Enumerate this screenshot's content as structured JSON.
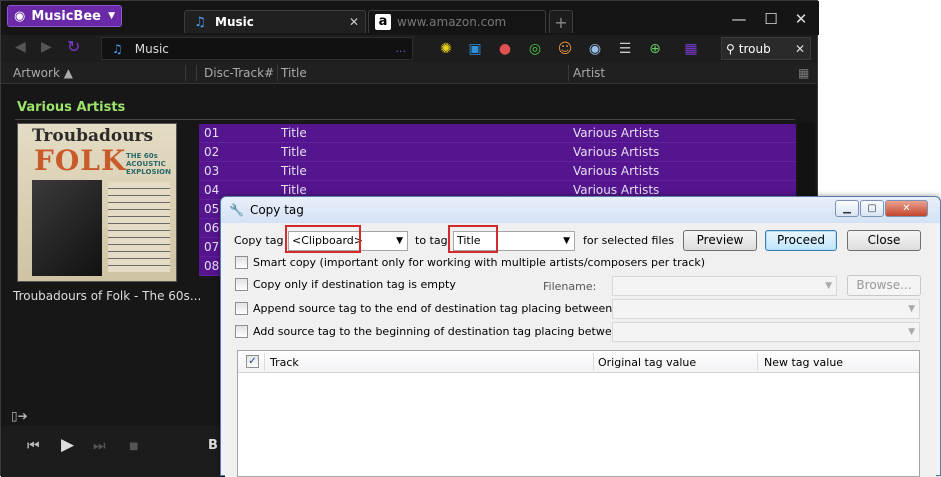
{
  "app": {
    "name": "MusicBee"
  },
  "tabs": [
    {
      "label": "Music",
      "close": "✕"
    },
    {
      "label": "www.amazon.com"
    }
  ],
  "window_controls": {
    "minimize": "—",
    "maximize": "☐",
    "close": "✕"
  },
  "toolbar": {
    "location": "Music",
    "location_more": "...",
    "search_value": "troub",
    "search_clear": "✕"
  },
  "columns": {
    "artwork": "Artwork ▲",
    "disc_track": "Disc-Track#",
    "title": "Title",
    "artist": "Artist"
  },
  "group": {
    "title": "Various Artists",
    "album_caption": "Troubadours of Folk - The 60s...",
    "art_title_1": "Troubadours",
    "art_title_2": "FOLK",
    "art_subtitle": "THE 60s ACOUSTIC EXPLOSION"
  },
  "tracks": [
    {
      "num": "01",
      "title": "Title",
      "artist": "Various Artists"
    },
    {
      "num": "02",
      "title": "Title",
      "artist": "Various Artists"
    },
    {
      "num": "03",
      "title": "Title",
      "artist": "Various Artists"
    },
    {
      "num": "04",
      "title": "Title",
      "artist": "Various Artists"
    },
    {
      "num": "05",
      "title": "",
      "artist": ""
    },
    {
      "num": "06",
      "title": "",
      "artist": ""
    },
    {
      "num": "07",
      "title": "",
      "artist": ""
    },
    {
      "num": "08",
      "title": "",
      "artist": ""
    }
  ],
  "player": {
    "partial_text": "B"
  },
  "dialog": {
    "title": "Copy tag",
    "copy_tag_label": "Copy tag",
    "source_tag": "<Clipboard>",
    "to_tag_label": "to tag",
    "dest_tag": "Title",
    "for_selected_label": "for selected files",
    "preview": "Preview",
    "proceed": "Proceed",
    "close": "Close",
    "smart_copy": "Smart copy (important only for working with multiple artists/composers per track)",
    "copy_only_empty": "Copy only if destination tag is empty",
    "filename_label": "Filename:",
    "browse": "Browse...",
    "append_label": "Append source tag to the end of destination tag placing between them:",
    "prepend_label": "Add source tag to the beginning of destination tag placing between them:",
    "grid_headers": {
      "track": "Track",
      "original": "Original tag value",
      "new": "New tag value"
    },
    "check_mark": "✓"
  },
  "colors": {
    "accent": "#6a2aa8",
    "selection": "#54158e",
    "group_title": "#9be36b"
  }
}
